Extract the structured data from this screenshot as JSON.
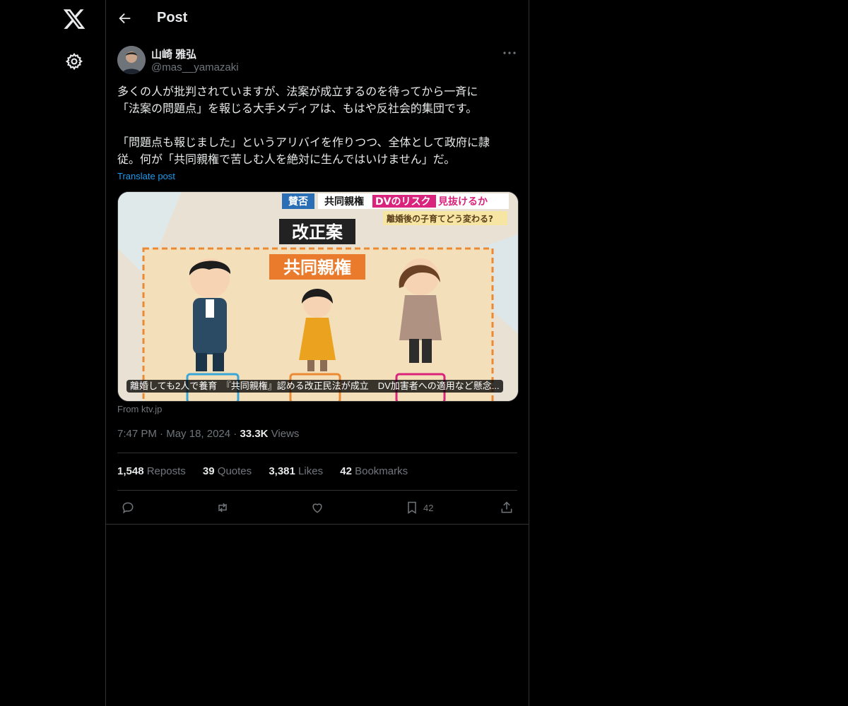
{
  "nav": {
    "logo": "x-logo-icon",
    "settings": "gear-icon"
  },
  "header": {
    "back_icon": "arrow-left-icon",
    "title": "Post"
  },
  "post": {
    "author_name": "山崎 雅弘",
    "author_handle": "@mas__yamazaki",
    "text_lines": [
      "多くの人が批判されていますが、法案が成立するのを待ってから一斉に",
      "「法案の問題点」を報じる大手メディアは、もはや反社会的集団です。",
      "「問題点も報じました」というアリバイを作りつつ、全体として政府に隷",
      "従。何が「共同親権で苦しむ人を絶対に生んではいけません」だ。"
    ],
    "translate_label": "Translate post",
    "media": {
      "badge": "賛否",
      "headline_1": "共同親権",
      "headline_2": "DVのリスク",
      "headline_3": "見抜けるか",
      "subheadline": "離婚後の子育てどう変わる?",
      "title_box": "改正案",
      "inner_label": "共同親権",
      "caption": "離婚しても2人で養育　『共同親権』認める改正民法が成立　DV加害者への適用など懸念..."
    },
    "source": "From ktv.jp",
    "time": "7:47 PM",
    "date": "May 18, 2024",
    "views_count": "33.3K",
    "views_label": "Views",
    "stats": {
      "reposts_count": "1,548",
      "reposts_label": "Reposts",
      "quotes_count": "39",
      "quotes_label": "Quotes",
      "likes_count": "3,381",
      "likes_label": "Likes",
      "bookmarks_count": "42",
      "bookmarks_label": "Bookmarks"
    },
    "actions": {
      "bookmark_count": "42"
    }
  }
}
